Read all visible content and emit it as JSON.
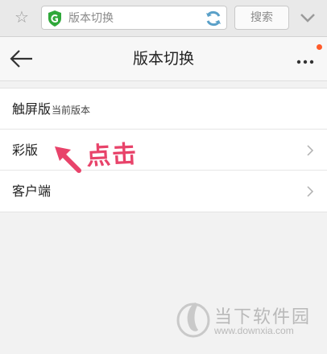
{
  "browser": {
    "address_text": "版本切换",
    "search_label": "搜索"
  },
  "header": {
    "title": "版本切换"
  },
  "list": [
    {
      "label": "触屏版",
      "sub": "当前版本"
    },
    {
      "label": "彩版",
      "sub": ""
    },
    {
      "label": "客户端",
      "sub": ""
    }
  ],
  "annotation": {
    "text": "点击",
    "color": "#e8436a"
  },
  "watermark": {
    "name": "当下软件园",
    "url": "www.downxia.com"
  },
  "colors": {
    "accent_green": "#2fa83a",
    "notification_dot": "#ff5b2a"
  }
}
